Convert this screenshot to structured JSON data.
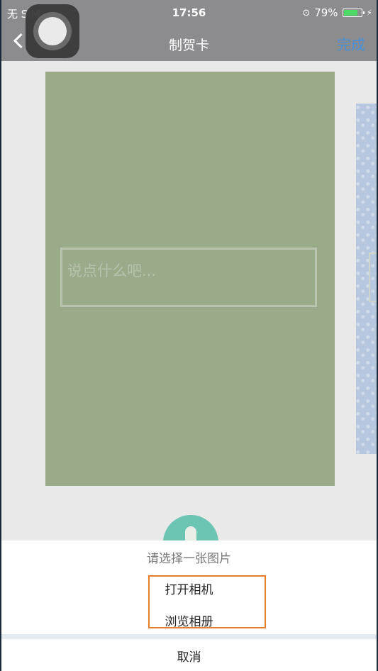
{
  "status": {
    "carrier": "无 SIM",
    "time": "17:56",
    "battery": "79%",
    "battery_level": 0.79
  },
  "navbar": {
    "title": "制贺卡",
    "done_label": "完成"
  },
  "card": {
    "message_placeholder": "说点什么吧..."
  },
  "action_sheet": {
    "title": "请选择一张图片",
    "options": [
      "打开相机",
      "浏览相册"
    ],
    "cancel": "取消"
  },
  "colors": {
    "accent_blue": "#4a90d9",
    "card_green": "#9aab8a",
    "highlight_orange": "#e87e2e",
    "mic_teal": "#6cc4b2"
  }
}
